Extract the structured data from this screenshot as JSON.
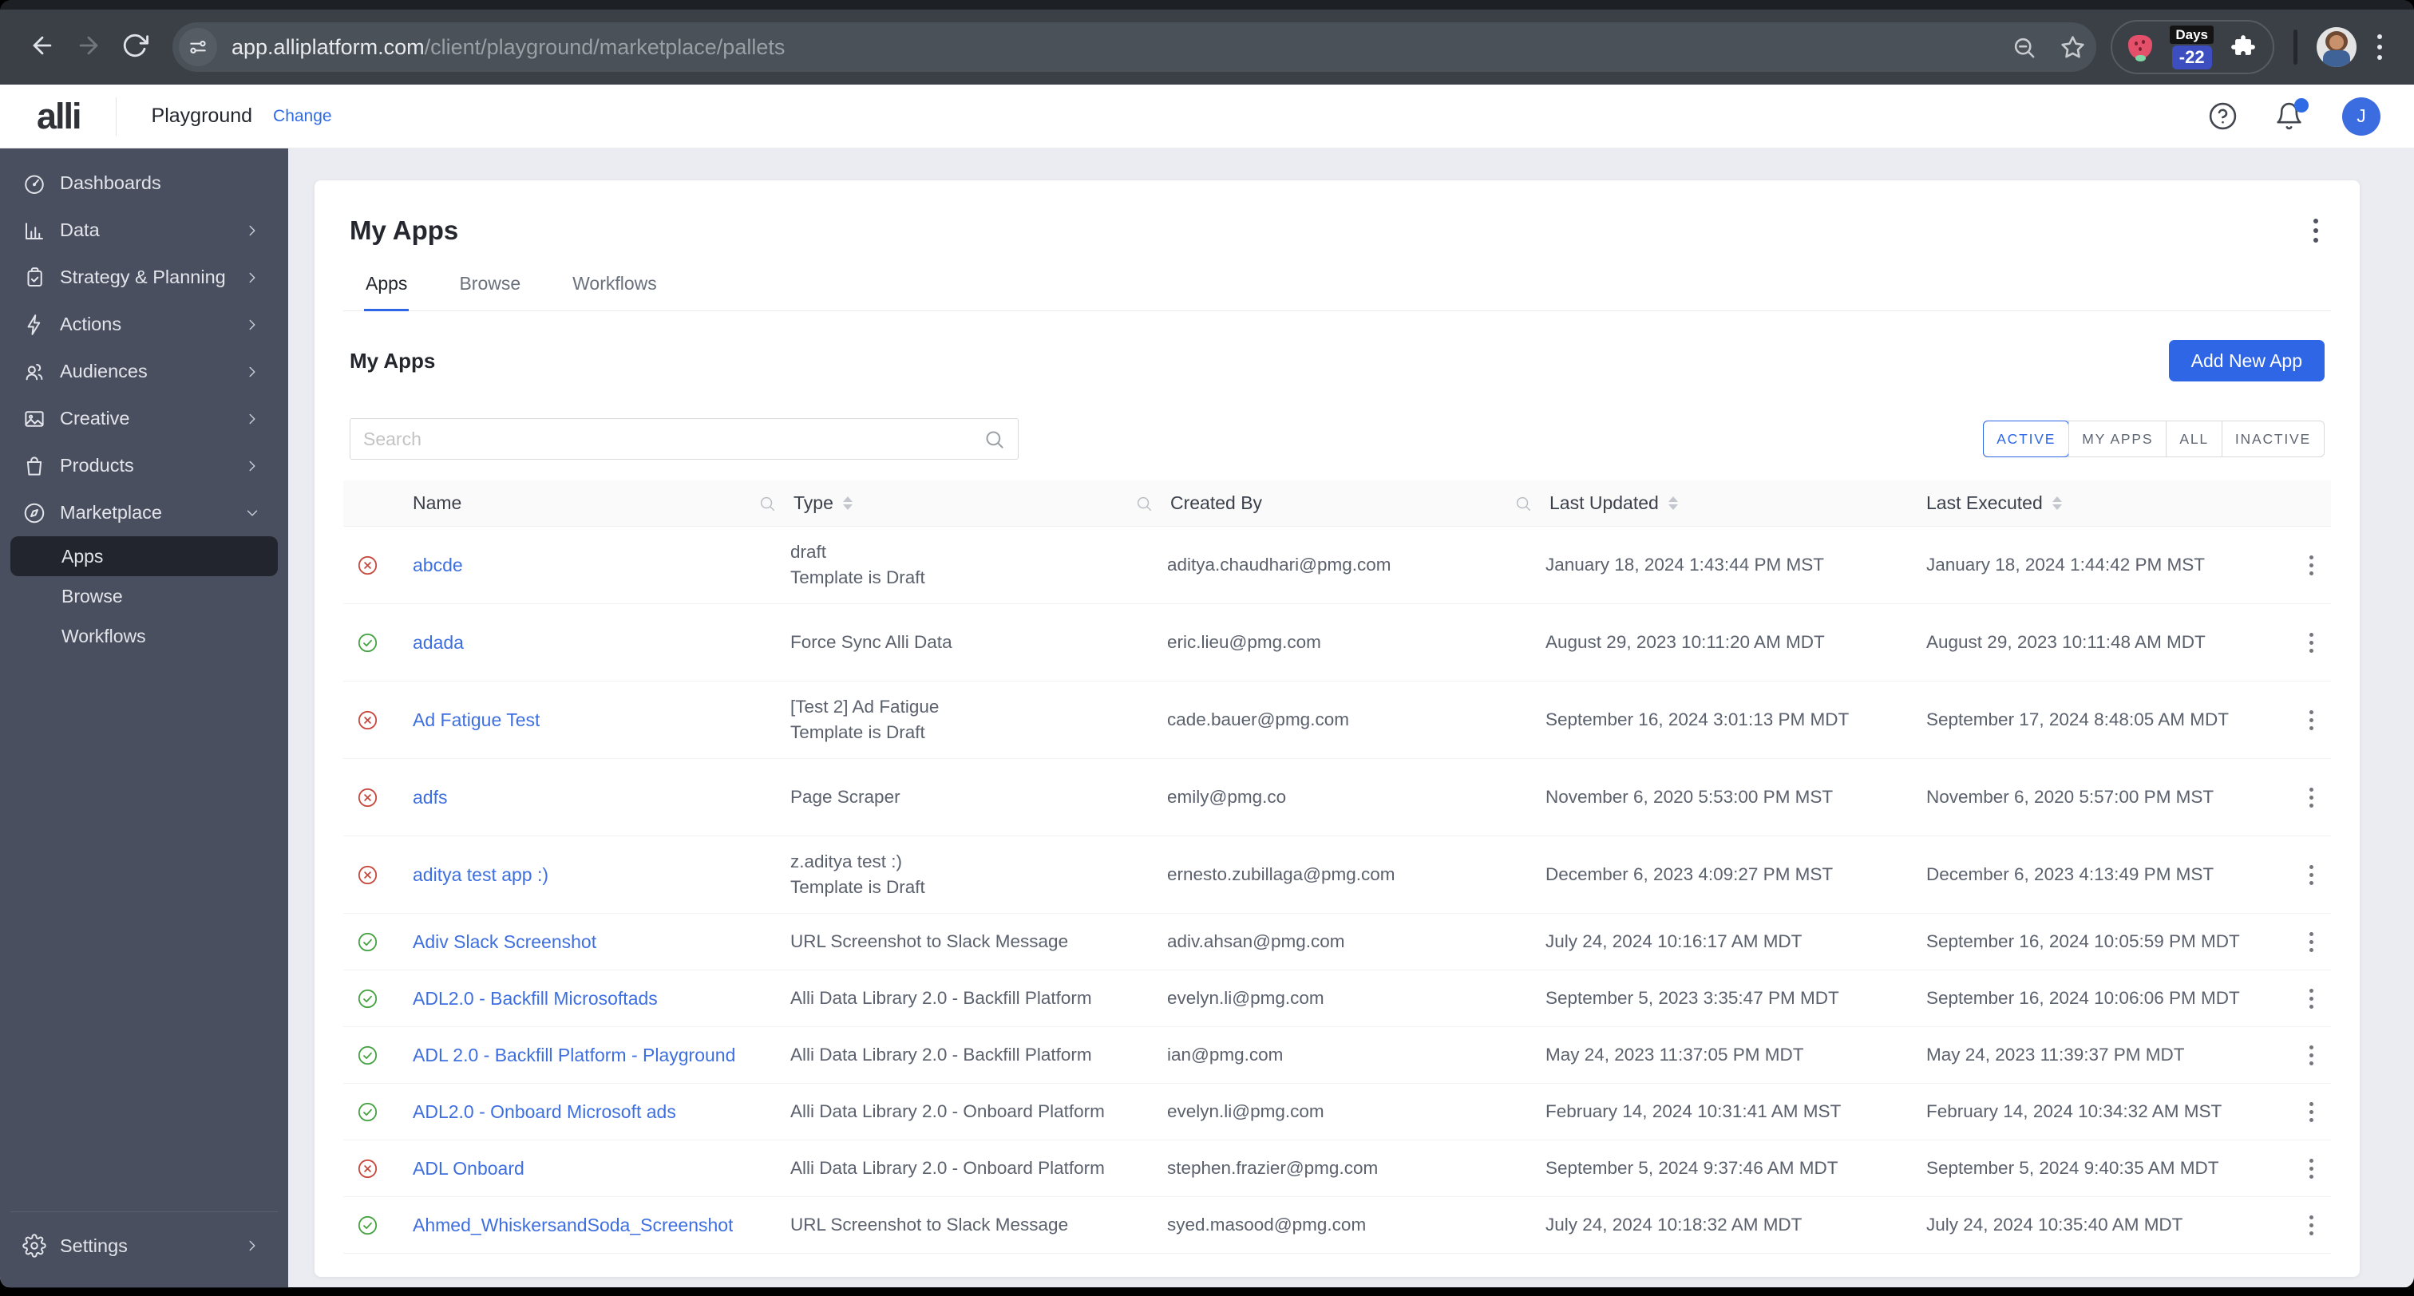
{
  "browser": {
    "url_domain": "app.alliplatform.com",
    "url_path": "/client/playground/marketplace/pallets",
    "days_badge": {
      "label": "Days",
      "value": "-22"
    }
  },
  "header": {
    "logo": "alli",
    "client_name": "Playground",
    "change_link": "Change",
    "avatar_initial": "J"
  },
  "sidebar": {
    "items": [
      {
        "label": "Dashboards",
        "icon": "dashboard",
        "chevron": null
      },
      {
        "label": "Data",
        "icon": "data",
        "chevron": "right"
      },
      {
        "label": "Strategy & Planning",
        "icon": "strategy",
        "chevron": "right"
      },
      {
        "label": "Actions",
        "icon": "actions",
        "chevron": "right"
      },
      {
        "label": "Audiences",
        "icon": "audiences",
        "chevron": "right"
      },
      {
        "label": "Creative",
        "icon": "creative",
        "chevron": "right"
      },
      {
        "label": "Products",
        "icon": "products",
        "chevron": "right"
      },
      {
        "label": "Marketplace",
        "icon": "marketplace",
        "chevron": "down",
        "children": [
          {
            "label": "Apps",
            "active": true
          },
          {
            "label": "Browse",
            "active": false
          },
          {
            "label": "Workflows",
            "active": false
          }
        ]
      }
    ],
    "footer_item": {
      "label": "Settings",
      "icon": "settings",
      "chevron": "right"
    }
  },
  "page": {
    "title": "My Apps",
    "tabs": [
      {
        "label": "Apps",
        "active": true
      },
      {
        "label": "Browse",
        "active": false
      },
      {
        "label": "Workflows",
        "active": false
      }
    ],
    "section_title": "My Apps",
    "add_button_label": "Add New App",
    "search_placeholder": "Search",
    "filters": {
      "options": [
        "ACTIVE",
        "MY APPS",
        "ALL",
        "INACTIVE"
      ],
      "active": "ACTIVE"
    },
    "table": {
      "columns": [
        {
          "label": "Name",
          "search": false,
          "sort": false
        },
        {
          "label": "Type",
          "search": true,
          "sort": true
        },
        {
          "label": "Created By",
          "search": true,
          "sort": false
        },
        {
          "label": "Last Updated",
          "search": true,
          "sort": true
        },
        {
          "label": "Last Executed",
          "search": false,
          "sort": true
        }
      ],
      "rows": [
        {
          "status": "error",
          "name": "abcde",
          "type_lines": [
            "draft",
            "Template is Draft"
          ],
          "created_by": "aditya.chaudhari@pmg.com",
          "last_updated": "January 18, 2024 1:43:44 PM MST",
          "last_executed": "January 18, 2024 1:44:42 PM MST"
        },
        {
          "status": "success",
          "name": "adada",
          "type_lines": [
            "Force Sync Alli Data"
          ],
          "created_by": "eric.lieu@pmg.com",
          "last_updated": "August 29, 2023 10:11:20 AM MDT",
          "last_executed": "August 29, 2023 10:11:48 AM MDT"
        },
        {
          "status": "error",
          "name": "Ad Fatigue Test",
          "type_lines": [
            "[Test 2] Ad Fatigue",
            "Template is Draft"
          ],
          "created_by": "cade.bauer@pmg.com",
          "last_updated": "September 16, 2024 3:01:13 PM MDT",
          "last_executed": "September 17, 2024 8:48:05 AM MDT"
        },
        {
          "status": "error",
          "name": "adfs",
          "type_lines": [
            "Page Scraper"
          ],
          "created_by": "emily@pmg.co",
          "last_updated": "November 6, 2020 5:53:00 PM MST",
          "last_executed": "November 6, 2020 5:57:00 PM MST"
        },
        {
          "status": "error",
          "name": "aditya test app :)",
          "type_lines": [
            "z.aditya test :)",
            "Template is Draft"
          ],
          "created_by": "ernesto.zubillaga@pmg.com",
          "last_updated": "December 6, 2023 4:09:27 PM MST",
          "last_executed": "December 6, 2023 4:13:49 PM MST"
        },
        {
          "status": "success",
          "name": "Adiv Slack Screenshot",
          "type_lines": [
            "URL Screenshot to Slack Message"
          ],
          "created_by": "adiv.ahsan@pmg.com",
          "last_updated": "July 24, 2024 10:16:17 AM MDT",
          "last_executed": "September 16, 2024 10:05:59 PM MDT"
        },
        {
          "status": "success",
          "name": "ADL2.0 - Backfill Microsoftads",
          "type_lines": [
            "Alli Data Library 2.0 - Backfill Platform"
          ],
          "created_by": "evelyn.li@pmg.com",
          "last_updated": "September 5, 2023 3:35:47 PM MDT",
          "last_executed": "September 16, 2024 10:06:06 PM MDT"
        },
        {
          "status": "success",
          "name": "ADL 2.0 - Backfill Platform - Playground",
          "type_lines": [
            "Alli Data Library 2.0 - Backfill Platform"
          ],
          "created_by": "ian@pmg.com",
          "last_updated": "May 24, 2023 11:37:05 PM MDT",
          "last_executed": "May 24, 2023 11:39:37 PM MDT"
        },
        {
          "status": "success",
          "name": "ADL2.0 - Onboard Microsoft ads",
          "type_lines": [
            "Alli Data Library 2.0 - Onboard Platform"
          ],
          "created_by": "evelyn.li@pmg.com",
          "last_updated": "February 14, 2024 10:31:41 AM MST",
          "last_executed": "February 14, 2024 10:34:32 AM MST"
        },
        {
          "status": "error",
          "name": "ADL Onboard",
          "type_lines": [
            "Alli Data Library 2.0 - Onboard Platform"
          ],
          "created_by": "stephen.frazier@pmg.com",
          "last_updated": "September 5, 2024 9:37:46 AM MDT",
          "last_executed": "September 5, 2024 9:40:35 AM MDT"
        },
        {
          "status": "success",
          "name": "Ahmed_WhiskersandSoda_Screenshot",
          "type_lines": [
            "URL Screenshot to Slack Message"
          ],
          "created_by": "syed.masood@pmg.com",
          "last_updated": "July 24, 2024 10:18:32 AM MDT",
          "last_executed": "July 24, 2024 10:35:40 AM MDT"
        }
      ]
    }
  },
  "colors": {
    "accent": "#2e66e5",
    "link": "#3e6fe0",
    "success": "#44a340",
    "error": "#c8473c",
    "sidebar_bg": "#4a4f5f",
    "toolbar_bg": "#3a4046"
  }
}
